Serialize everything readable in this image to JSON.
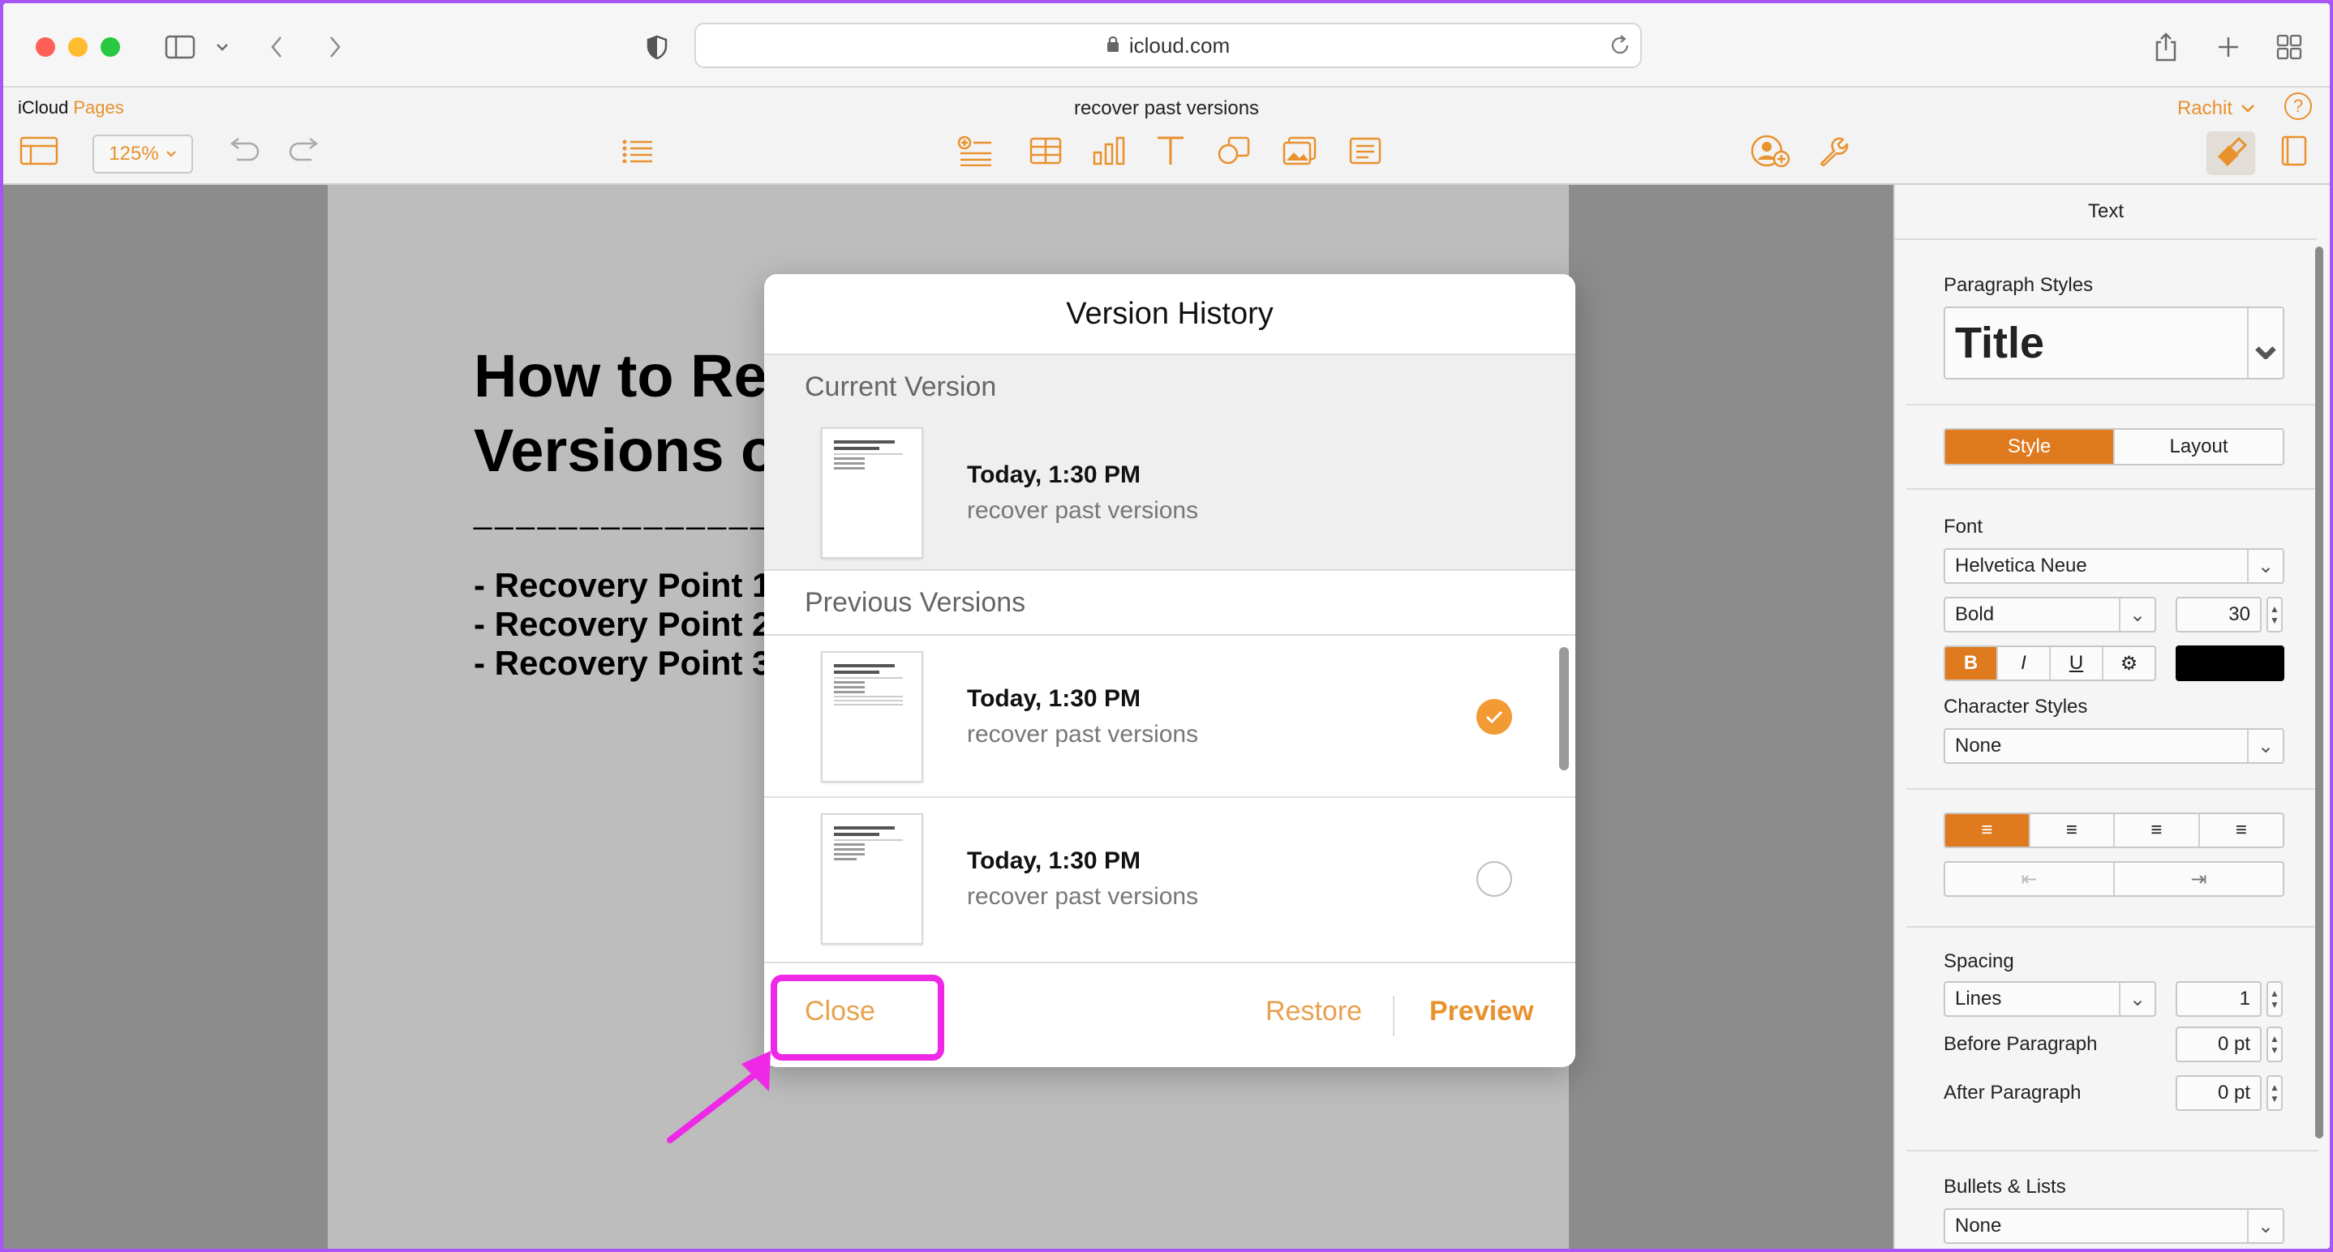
{
  "browser": {
    "url": "icloud.com",
    "icons": [
      "sidebar-icon",
      "chevron-down-icon",
      "back-icon",
      "forward-icon",
      "shield-icon",
      "lock-icon",
      "reload-icon",
      "share-icon",
      "plus-icon",
      "tabs-grid-icon"
    ]
  },
  "app": {
    "brand": "iCloud",
    "brand_app": "Pages",
    "document_title": "recover past versions",
    "user": "Rachit",
    "help": "?",
    "zoom": "125%"
  },
  "document": {
    "heading": "How to Re\nVersions o",
    "rule": "________________",
    "list": [
      "-  Recovery Point 1",
      "-  Recovery Point 2",
      "-  Recovery Point 3"
    ]
  },
  "sidebar": {
    "title": "Text",
    "paragraph_styles_label": "Paragraph Styles",
    "paragraph_style": "Title",
    "tabs": [
      "Style",
      "Layout"
    ],
    "font_label": "Font",
    "font_family": "Helvetica Neue",
    "font_weight": "Bold",
    "font_size": "30",
    "format_buttons": [
      "B",
      "I",
      "U",
      "⚙"
    ],
    "font_color": "#000000",
    "character_styles_label": "Character Styles",
    "character_style": "None",
    "spacing_label": "Spacing",
    "spacing_mode": "Lines",
    "spacing_value": "1",
    "before_paragraph_label": "Before Paragraph",
    "before_paragraph": "0 pt",
    "after_paragraph_label": "After Paragraph",
    "after_paragraph": "0 pt",
    "bullets_label": "Bullets & Lists",
    "bullets": "None"
  },
  "modal": {
    "title": "Version History",
    "current_label": "Current Version",
    "current": {
      "date": "Today, 1:30 PM",
      "name": "recover past versions"
    },
    "previous_label": "Previous Versions",
    "previous": [
      {
        "date": "Today, 1:30 PM",
        "name": "recover past versions",
        "selected": true
      },
      {
        "date": "Today, 1:30 PM",
        "name": "recover past versions",
        "selected": false
      }
    ],
    "close": "Close",
    "restore": "Restore",
    "preview": "Preview"
  },
  "colors": {
    "accent": "#e8912d",
    "annotation": "#ee28e6"
  }
}
